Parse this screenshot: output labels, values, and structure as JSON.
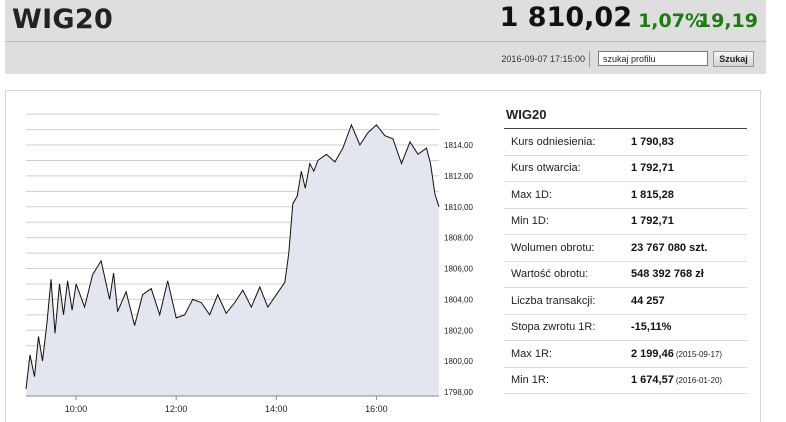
{
  "header": {
    "title": "WIG20",
    "price": "1 810,02",
    "change_pct": "1,07%",
    "change_abs": "19,19",
    "datetime": "2016-09-07 17:15:00",
    "search_value": "szukaj profilu",
    "search_button": "Szukaj",
    "change_color": "#1f7a12"
  },
  "stats": {
    "title": "WIG20",
    "rows": [
      {
        "label": "Kurs odniesienia:",
        "value": "1 790,83",
        "note": ""
      },
      {
        "label": "Kurs otwarcia:",
        "value": "1 792,71",
        "note": ""
      },
      {
        "label": "Max 1D:",
        "value": "1 815,28",
        "note": ""
      },
      {
        "label": "Min 1D:",
        "value": "1 792,71",
        "note": ""
      },
      {
        "label": "Wolumen obrotu:",
        "value": "23 767 080 szt.",
        "note": ""
      },
      {
        "label": "Wartość obrotu:",
        "value": "548 392 768 zł",
        "note": ""
      },
      {
        "label": "Liczba transakcji:",
        "value": "44 257",
        "note": ""
      },
      {
        "label": "Stopa zwrotu 1R:",
        "value": "-15,11%",
        "note": ""
      },
      {
        "label": "Max 1R:",
        "value": "2 199,46",
        "note": "(2015-09-17)"
      },
      {
        "label": "Min 1R:",
        "value": "1 674,57",
        "note": "(2016-01-20)"
      }
    ]
  },
  "chart_data": {
    "type": "area",
    "title": "",
    "xlabel": "",
    "ylabel": "",
    "x_ticks": [
      "10:00",
      "12:00",
      "14:00",
      "16:00"
    ],
    "y_ticks": [
      "1798,00",
      "1800,00",
      "1802,00",
      "1804,00",
      "1806,00",
      "1808,00",
      "1810,00",
      "1812,00",
      "1814,00"
    ],
    "ylim": [
      1797.5,
      1816.5
    ],
    "xlim": [
      9.0,
      17.25
    ],
    "grid": true,
    "line_color": "#111111",
    "fill_color": "#e3e6ee",
    "series": [
      {
        "x": [
          9.0,
          9.08,
          9.17,
          9.25,
          9.33,
          9.42,
          9.5,
          9.58,
          9.67,
          9.75,
          9.83,
          9.92,
          10.0,
          10.17,
          10.33,
          10.5,
          10.67,
          10.75,
          10.83,
          11.0,
          11.17,
          11.33,
          11.5,
          11.67,
          11.83,
          12.0,
          12.17,
          12.33,
          12.5,
          12.67,
          12.83,
          13.0,
          13.17,
          13.33,
          13.5,
          13.67,
          13.83,
          14.0,
          14.17,
          14.25,
          14.33,
          14.42,
          14.5,
          14.58,
          14.67,
          14.75,
          14.83,
          15.0,
          15.17,
          15.33,
          15.5,
          15.67,
          15.83,
          16.0,
          16.17,
          16.33,
          16.5,
          16.67,
          16.83,
          17.0,
          17.08,
          17.17,
          17.25
        ],
        "y": [
          1798.2,
          1800.4,
          1799.0,
          1801.6,
          1800.0,
          1802.5,
          1805.3,
          1801.8,
          1805.0,
          1803.0,
          1805.2,
          1803.3,
          1805.0,
          1803.5,
          1805.6,
          1806.5,
          1804.0,
          1805.7,
          1803.2,
          1804.5,
          1802.3,
          1804.3,
          1804.7,
          1803.0,
          1805.2,
          1802.8,
          1803.0,
          1804.0,
          1803.8,
          1803.0,
          1804.3,
          1803.1,
          1803.8,
          1804.6,
          1803.5,
          1804.8,
          1803.5,
          1804.3,
          1805.1,
          1807.0,
          1810.2,
          1810.7,
          1812.3,
          1811.2,
          1812.8,
          1812.3,
          1813.0,
          1813.4,
          1812.9,
          1813.8,
          1815.3,
          1814.0,
          1814.8,
          1815.3,
          1814.6,
          1814.4,
          1812.8,
          1814.2,
          1813.4,
          1813.8,
          1812.8,
          1810.8,
          1810.0
        ]
      }
    ]
  }
}
